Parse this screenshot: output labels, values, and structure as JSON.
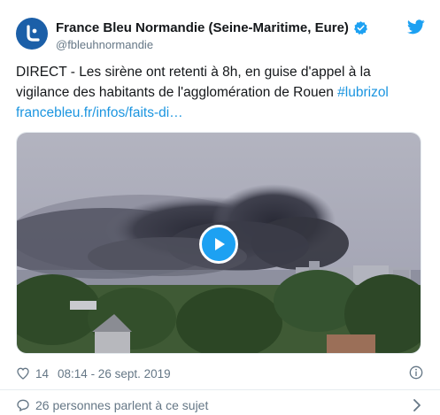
{
  "account": {
    "display_name": "France Bleu Normandie (Seine-Maritime, Eure)",
    "handle": "@fbleuhnormandie",
    "verified": true
  },
  "tweet": {
    "text_main": "DIRECT - Les sirène ont retenti à 8h, en guise d'appel à la vigilance des habitants de l'agglomération de Rouen ",
    "hashtag": "#lubrizol",
    "link": "francebleu.fr/infos/faits-di…"
  },
  "media": {
    "type": "video"
  },
  "footer": {
    "likes": "14",
    "timestamp": "08:14 - 26 sept. 2019"
  },
  "conversation": {
    "label": "26 personnes parlent à ce sujet"
  },
  "colors": {
    "accent": "#1da1f2",
    "link": "#1b95e0",
    "secondary_text": "#657786",
    "primary_text": "#14171a",
    "avatar_bg": "#1b5fa8"
  },
  "icons": [
    "avatar-logo",
    "verified-icon",
    "twitter-bird-icon",
    "play-icon",
    "heart-icon",
    "info-icon",
    "conversation-icon",
    "chevron-right-icon"
  ]
}
